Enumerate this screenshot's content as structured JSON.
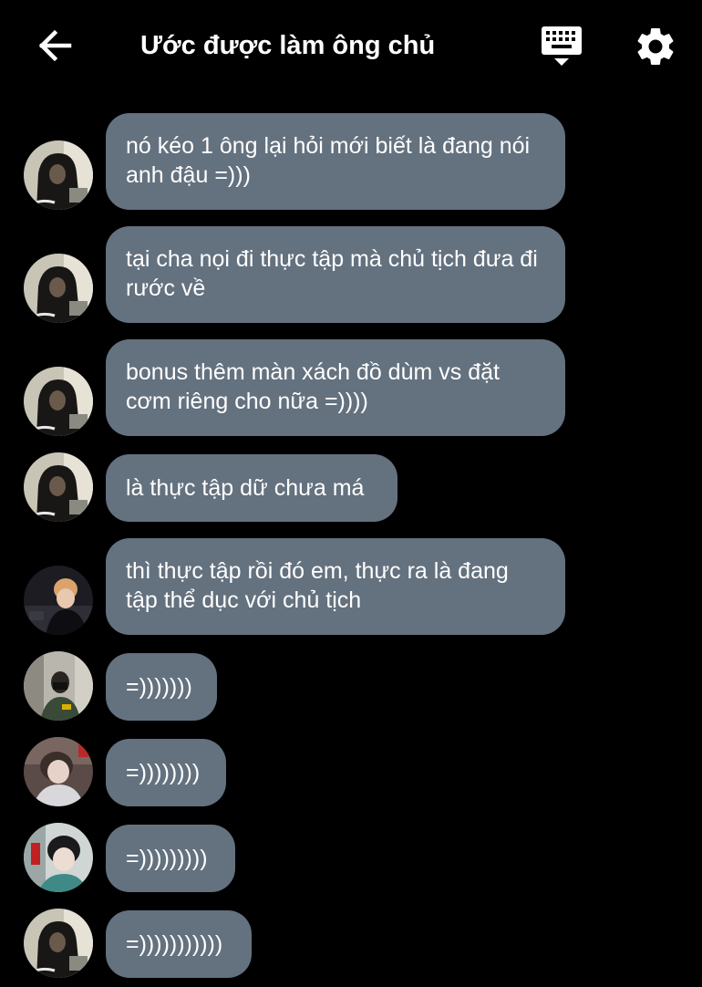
{
  "header": {
    "title": "Ước được làm ông chủ",
    "back_icon": "arrow-left-icon",
    "keyboard_icon": "keyboard-icon",
    "settings_icon": "gear-icon"
  },
  "theme": {
    "background": "#000000",
    "bubble": "#64717f",
    "text": "#ffffff"
  },
  "messages": [
    {
      "text": "nó kéo 1 ông lại hỏi mới biết là đang nói anh đậu =)))",
      "sender": "user-1"
    },
    {
      "text": "tại cha nọi đi thực tập mà chủ tịch đưa đi rước về",
      "sender": "user-1"
    },
    {
      "text": "bonus thêm màn xách đồ dùm vs đặt cơm riêng cho nữa =))))",
      "sender": "user-1"
    },
    {
      "text": "là thực tập dữ chưa má",
      "sender": "user-1"
    },
    {
      "text": "thì thực tập rồi đó em, thực ra là đang tập thể dục với chủ tịch",
      "sender": "user-2"
    },
    {
      "text": "=)))))))",
      "sender": "user-3"
    },
    {
      "text": "=))))))))",
      "sender": "user-4"
    },
    {
      "text": "=)))))))))",
      "sender": "user-5"
    },
    {
      "text": "=)))))))))))",
      "sender": "user-1"
    }
  ]
}
